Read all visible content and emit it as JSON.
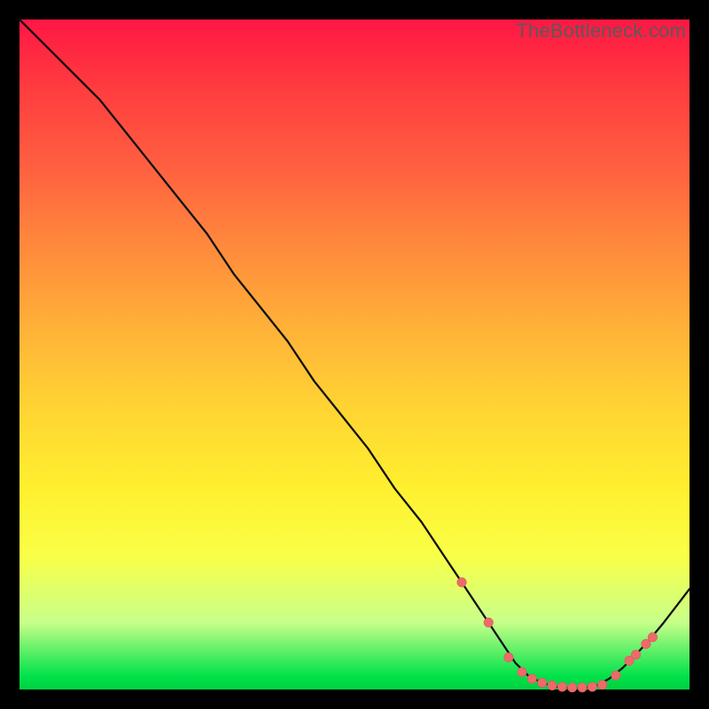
{
  "watermark": "TheBottleneck.com",
  "colors": {
    "curve_stroke": "#111111",
    "marker_fill": "#ed6a6a",
    "marker_stroke": "#d85c5c"
  },
  "chart_data": {
    "type": "line",
    "title": "",
    "xlabel": "",
    "ylabel": "",
    "xlim": [
      0,
      100
    ],
    "ylim": [
      0,
      100
    ],
    "grid": false,
    "series": [
      {
        "name": "bottleneck-curve",
        "x": [
          0,
          4,
          8,
          12,
          16,
          20,
          24,
          28,
          32,
          36,
          40,
          44,
          48,
          52,
          56,
          60,
          64,
          66,
          68,
          70,
          72,
          74,
          76,
          78,
          80,
          82,
          84,
          86,
          88,
          90,
          92,
          94,
          96,
          98,
          100
        ],
        "y": [
          100,
          96,
          92,
          88,
          83,
          78,
          73,
          68,
          62,
          57,
          52,
          46,
          41,
          36,
          30,
          25,
          19,
          16,
          13,
          10,
          7,
          4,
          2,
          1,
          0.4,
          0.2,
          0.2,
          0.5,
          1.6,
          3.2,
          5.2,
          7.4,
          9.8,
          12.4,
          15
        ]
      }
    ],
    "markers": {
      "name": "highlight-dots",
      "x": [
        66,
        70,
        73,
        75,
        76.5,
        78,
        79.5,
        81,
        82.5,
        84,
        85.5,
        87,
        89,
        91,
        92,
        93.5,
        94.5
      ],
      "y": [
        16,
        10,
        4.8,
        2.6,
        1.6,
        1.0,
        0.6,
        0.4,
        0.3,
        0.3,
        0.4,
        0.7,
        2.1,
        4.3,
        5.2,
        6.8,
        7.8
      ]
    }
  }
}
